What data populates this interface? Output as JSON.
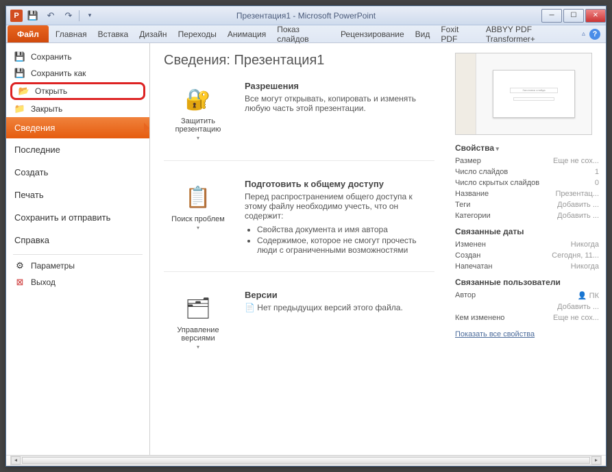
{
  "title": "Презентация1 - Microsoft PowerPoint",
  "app_letter": "P",
  "tabs": {
    "file": "Файл",
    "list": [
      "Главная",
      "Вставка",
      "Дизайн",
      "Переходы",
      "Анимация",
      "Показ слайдов",
      "Рецензирование",
      "Вид",
      "Foxit PDF",
      "ABBYY PDF Transformer+"
    ]
  },
  "sidebar": {
    "save": "Сохранить",
    "saveas": "Сохранить как",
    "open": "Открыть",
    "close": "Закрыть",
    "info": "Сведения",
    "recent": "Последние",
    "new": "Создать",
    "print": "Печать",
    "share": "Сохранить и отправить",
    "help": "Справка",
    "options": "Параметры",
    "exit": "Выход"
  },
  "main": {
    "title": "Сведения: Презентация1",
    "protect_btn": "Защитить презентацию",
    "perm_title": "Разрешения",
    "perm_body": "Все могут открывать, копировать и изменять любую часть этой презентации.",
    "check_btn": "Поиск проблем",
    "share_title": "Подготовить к общему доступу",
    "share_body": "Перед распространением общего доступа к этому файлу необходимо учесть, что он содержит:",
    "share_li1": "Свойства документа и имя автора",
    "share_li2": "Содержимое, которое не смогут прочесть люди с ограниченными возможностями",
    "ver_btn": "Управление версиями",
    "ver_title": "Версии",
    "ver_body": "Нет предыдущих версий этого файла."
  },
  "props": {
    "head": "Свойства",
    "size_l": "Размер",
    "size_v": "Еще не сох...",
    "slides_l": "Число слайдов",
    "slides_v": "1",
    "hidden_l": "Число скрытых слайдов",
    "hidden_v": "0",
    "name_l": "Название",
    "name_v": "Презентац...",
    "tags_l": "Теги",
    "tags_v": "Добавить ...",
    "cat_l": "Категории",
    "cat_v": "Добавить ...",
    "dates_head": "Связанные даты",
    "mod_l": "Изменен",
    "mod_v": "Никогда",
    "created_l": "Создан",
    "created_v": "Сегодня, 11...",
    "printed_l": "Напечатан",
    "printed_v": "Никогда",
    "people_head": "Связанные пользователи",
    "author_l": "Автор",
    "author_v": "ПК",
    "addauthor": "Добавить ...",
    "changedby_l": "Кем изменено",
    "changedby_v": "Еще не сох...",
    "showall": "Показать все свойства"
  },
  "thumb_title": "Заголовок слайда"
}
